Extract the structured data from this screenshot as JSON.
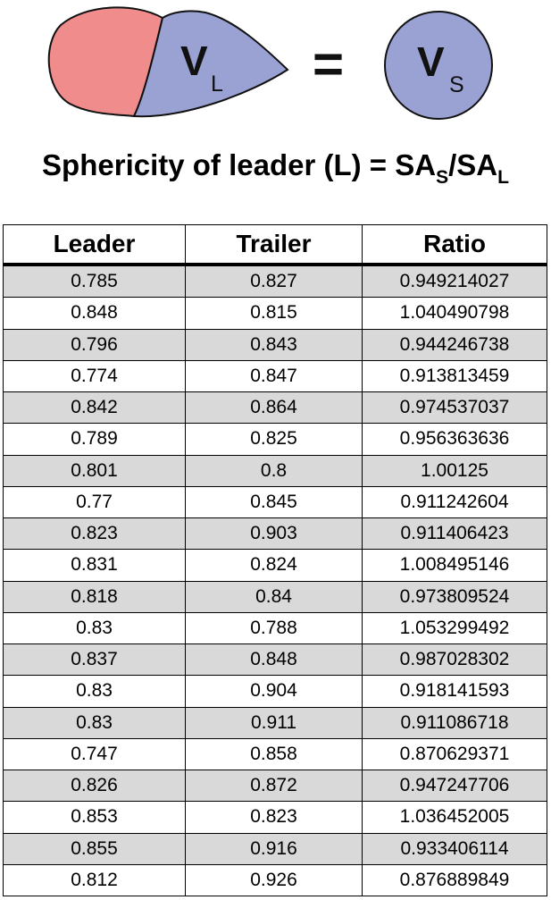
{
  "diagram": {
    "leader_letter": "V",
    "leader_sub": "L",
    "equals": "=",
    "sphere_letter": "V",
    "sphere_sub": "S",
    "colors": {
      "trailer_fill": "#f08c8c",
      "leader_fill": "#9aa2d4",
      "sphere_fill": "#9aa2d4",
      "outline": "#111111"
    }
  },
  "formula": {
    "prefix": "Sphericity of leader (L) = SA",
    "sub1": "S",
    "middle": "/SA",
    "sub2": "L"
  },
  "table": {
    "headers": [
      "Leader",
      "Trailer",
      "Ratio"
    ],
    "rows": [
      [
        "0.785",
        "0.827",
        "0.949214027"
      ],
      [
        "0.848",
        "0.815",
        "1.040490798"
      ],
      [
        "0.796",
        "0.843",
        "0.944246738"
      ],
      [
        "0.774",
        "0.847",
        "0.913813459"
      ],
      [
        "0.842",
        "0.864",
        "0.974537037"
      ],
      [
        "0.789",
        "0.825",
        "0.956363636"
      ],
      [
        "0.801",
        "0.8",
        "1.00125"
      ],
      [
        "0.77",
        "0.845",
        "0.911242604"
      ],
      [
        "0.823",
        "0.903",
        "0.911406423"
      ],
      [
        "0.831",
        "0.824",
        "1.008495146"
      ],
      [
        "0.818",
        "0.84",
        "0.973809524"
      ],
      [
        "0.83",
        "0.788",
        "1.053299492"
      ],
      [
        "0.837",
        "0.848",
        "0.987028302"
      ],
      [
        "0.83",
        "0.904",
        "0.918141593"
      ],
      [
        "0.83",
        "0.911",
        "0.911086718"
      ],
      [
        "0.747",
        "0.858",
        "0.870629371"
      ],
      [
        "0.826",
        "0.872",
        "0.947247706"
      ],
      [
        "0.853",
        "0.823",
        "1.036452005"
      ],
      [
        "0.855",
        "0.916",
        "0.933406114"
      ],
      [
        "0.812",
        "0.926",
        "0.876889849"
      ]
    ]
  }
}
